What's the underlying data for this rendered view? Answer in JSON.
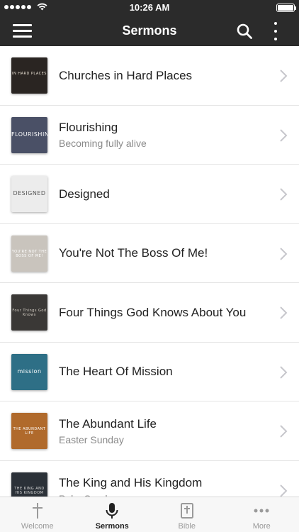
{
  "status": {
    "time": "10:26 AM"
  },
  "header": {
    "title": "Sermons"
  },
  "sermons": [
    {
      "title": "Churches in Hard Places",
      "subtitle": "",
      "thumb_text": "IN HARD PLACES",
      "thumb_bg": "#2a2522",
      "thumb_fg": "#e8e0d4"
    },
    {
      "title": "Flourishing",
      "subtitle": "Becoming fully alive",
      "thumb_text": "FLOURISHING",
      "thumb_bg": "#4a5066",
      "thumb_fg": "#ffffff"
    },
    {
      "title": "Designed",
      "subtitle": "",
      "thumb_text": "DESIGNED",
      "thumb_bg": "#ececec",
      "thumb_fg": "#555555"
    },
    {
      "title": "You're Not The Boss Of Me!",
      "subtitle": "",
      "thumb_text": "YOU'RE NOT THE BOSS OF ME!",
      "thumb_bg": "#c9c4bd",
      "thumb_fg": "#ffffff"
    },
    {
      "title": "Four Things God Knows About You",
      "subtitle": "",
      "thumb_text": "Four Things God Knows",
      "thumb_bg": "#3a3836",
      "thumb_fg": "#d8d2c8"
    },
    {
      "title": "The Heart Of Mission",
      "subtitle": "",
      "thumb_text": "mission",
      "thumb_bg": "#2e6f86",
      "thumb_fg": "#ffffff"
    },
    {
      "title": "The Abundant Life",
      "subtitle": "Easter Sunday",
      "thumb_text": "THE ABUNDANT LIFE",
      "thumb_bg": "#b06a2c",
      "thumb_fg": "#ffffff"
    },
    {
      "title": "The King and His Kingdom",
      "subtitle": "Palm Sunday",
      "thumb_text": "THE KING AND HIS KINGDOM",
      "thumb_bg": "#2b3138",
      "thumb_fg": "#d9d9d9"
    }
  ],
  "tabs": [
    {
      "label": "Welcome",
      "icon": "cross-icon",
      "active": false
    },
    {
      "label": "Sermons",
      "icon": "microphone-icon",
      "active": true
    },
    {
      "label": "Bible",
      "icon": "bible-icon",
      "active": false
    },
    {
      "label": "More",
      "icon": "ellipsis-icon",
      "active": false
    }
  ],
  "colors": {
    "header_bg": "#2b2b2b",
    "active_tab": "#222222",
    "inactive_tab": "#9a9a9a"
  }
}
